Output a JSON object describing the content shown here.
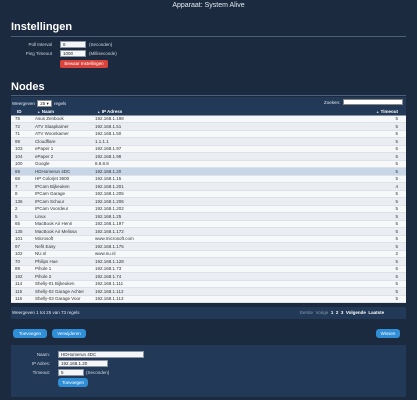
{
  "window": {
    "title": "Apparaat: System Alive"
  },
  "settings": {
    "title": "Instellingen",
    "poll_label": "Poll Interval",
    "poll_value": "6",
    "poll_unit": "(Seconden)",
    "ping_label": "Ping Timeout",
    "ping_value": "1000",
    "ping_unit": "(Milliseconde)",
    "save_button": "Bewaar Instellingen"
  },
  "nodes": {
    "title": "Nodes",
    "show_prefix": "Weergeven",
    "page_length": "25",
    "show_suffix": "regels",
    "search_label": "Zoeken:",
    "columns": [
      "ID",
      "Naam",
      "IP Adress",
      "Timeout"
    ],
    "rows": [
      {
        "id": "75",
        "name": "Asus Zenbook",
        "ip": "192.168.1.198",
        "timeout": "5"
      },
      {
        "id": "72",
        "name": "ATV Slaapkamer",
        "ip": "192.168.1.51",
        "timeout": "5"
      },
      {
        "id": "71",
        "name": "ATV Woonkamer",
        "ip": "192.168.1.50",
        "timeout": "5"
      },
      {
        "id": "99",
        "name": "Cloudflare",
        "ip": "1.1.1.1",
        "timeout": "5"
      },
      {
        "id": "103",
        "name": "ePaper 1",
        "ip": "192.168.1.97",
        "timeout": "5"
      },
      {
        "id": "104",
        "name": "ePaper 2",
        "ip": "192.168.1.98",
        "timeout": "5"
      },
      {
        "id": "100",
        "name": "Google",
        "ip": "8.8.8.8",
        "timeout": "5"
      },
      {
        "id": "69",
        "name": "HDHomerun 4DC",
        "ip": "192.168.1.20",
        "timeout": "5"
      },
      {
        "id": "68",
        "name": "HP Colorjet 3600",
        "ip": "192.168.1.15",
        "timeout": "5"
      },
      {
        "id": "7",
        "name": "IPCam Bijkeuken",
        "ip": "192.168.1.201",
        "timeout": "4"
      },
      {
        "id": "8",
        "name": "IPCam Garage",
        "ip": "192.168.1.205",
        "timeout": "5"
      },
      {
        "id": "136",
        "name": "IPCam Schuur",
        "ip": "192.168.1.206",
        "timeout": "5"
      },
      {
        "id": "2",
        "name": "IPCam Voordeur",
        "ip": "192.168.1.202",
        "timeout": "5"
      },
      {
        "id": "5",
        "name": "Linux",
        "ip": "192.168.1.25",
        "timeout": "5"
      },
      {
        "id": "65",
        "name": "MacBook Air Henri",
        "ip": "192.168.1.197",
        "timeout": "5"
      },
      {
        "id": "135",
        "name": "MacBook Air Melissa",
        "ip": "192.168.1.172",
        "timeout": "5"
      },
      {
        "id": "101",
        "name": "Microsoft",
        "ip": "www.microsoft.com",
        "timeout": "5"
      },
      {
        "id": "97",
        "name": "Nefit Easy",
        "ip": "192.168.1.175",
        "timeout": "5"
      },
      {
        "id": "102",
        "name": "NU.nl",
        "ip": "www.nu.nl",
        "timeout": "2"
      },
      {
        "id": "70",
        "name": "Philips Hue",
        "ip": "192.168.1.128",
        "timeout": "5"
      },
      {
        "id": "89",
        "name": "Pihole 1",
        "ip": "192.168.1.73",
        "timeout": "5"
      },
      {
        "id": "192",
        "name": "Pihole 2",
        "ip": "192.168.1.74",
        "timeout": "5"
      },
      {
        "id": "114",
        "name": "Shelly-01 Bijkeuken",
        "ip": "192.168.1.111",
        "timeout": "5"
      },
      {
        "id": "115",
        "name": "Shelly-02 Garage Achter",
        "ip": "192.168.1.112",
        "timeout": "5"
      },
      {
        "id": "116",
        "name": "Shelly-03 Garage Voor",
        "ip": "192.168.1.113",
        "timeout": "5"
      }
    ],
    "selected_row": 7,
    "info": "Weergeven 1 tot 25 van 73 regels",
    "pager": {
      "first": "Eerste",
      "prev": "Vorige",
      "pages": [
        "1",
        "2",
        "3"
      ],
      "next": "Volgende",
      "last": "Laatste"
    }
  },
  "actions": {
    "add": "Toevoegen",
    "edit": "Verwijderen",
    "delete": "Wissen"
  },
  "detail": {
    "name_label": "Naam:",
    "name_value": "HDHomerun 4DC",
    "ip_label": "IP Adres:",
    "ip_value": "192.168.1.20",
    "timeout_label": "Timeout:",
    "timeout_value": "5",
    "timeout_unit": "(Seconden)",
    "update_button": "Toevoegen"
  },
  "colors": {
    "background": "#1b2a3f",
    "panel": "#223a57",
    "accent_blue": "#2f8ed6",
    "accent_red": "#d9433c"
  }
}
